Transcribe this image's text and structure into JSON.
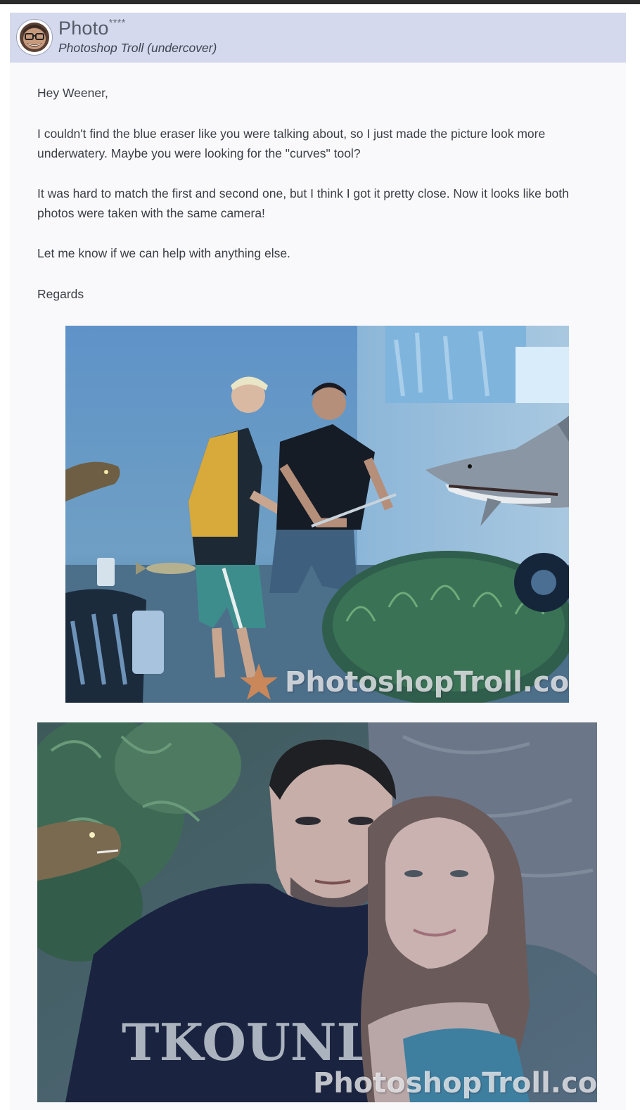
{
  "post": {
    "author_name": "Photo",
    "author_name_suffix": "****",
    "author_role": "Photoshop Troll (undercover)",
    "greeting": "Hey Weener,",
    "paragraph_1": "I couldn't find the blue eraser like you were talking about, so I just made the picture look more underwatery. Maybe you were looking for the \"curves\" tool?",
    "paragraph_2": "It was hard to match the first and second one, but I think I got it pretty close. Now it looks like both photos were taken with the same camera!",
    "paragraph_3": "Let me know if we can help with anything else.",
    "sign_off": "Regards"
  },
  "images": [
    {
      "watermark": "PhotoshopTroll.com",
      "icon": "underwater-photo-shark-eel"
    },
    {
      "watermark": "PhotoshopTroll.com",
      "icon": "underwater-couple-selfie-eel"
    }
  ],
  "colors": {
    "header_bg": "#d4d9ed",
    "card_bg": "#f9f9fb",
    "text": "#3a3e45",
    "topbar": "#2b2b2b"
  }
}
